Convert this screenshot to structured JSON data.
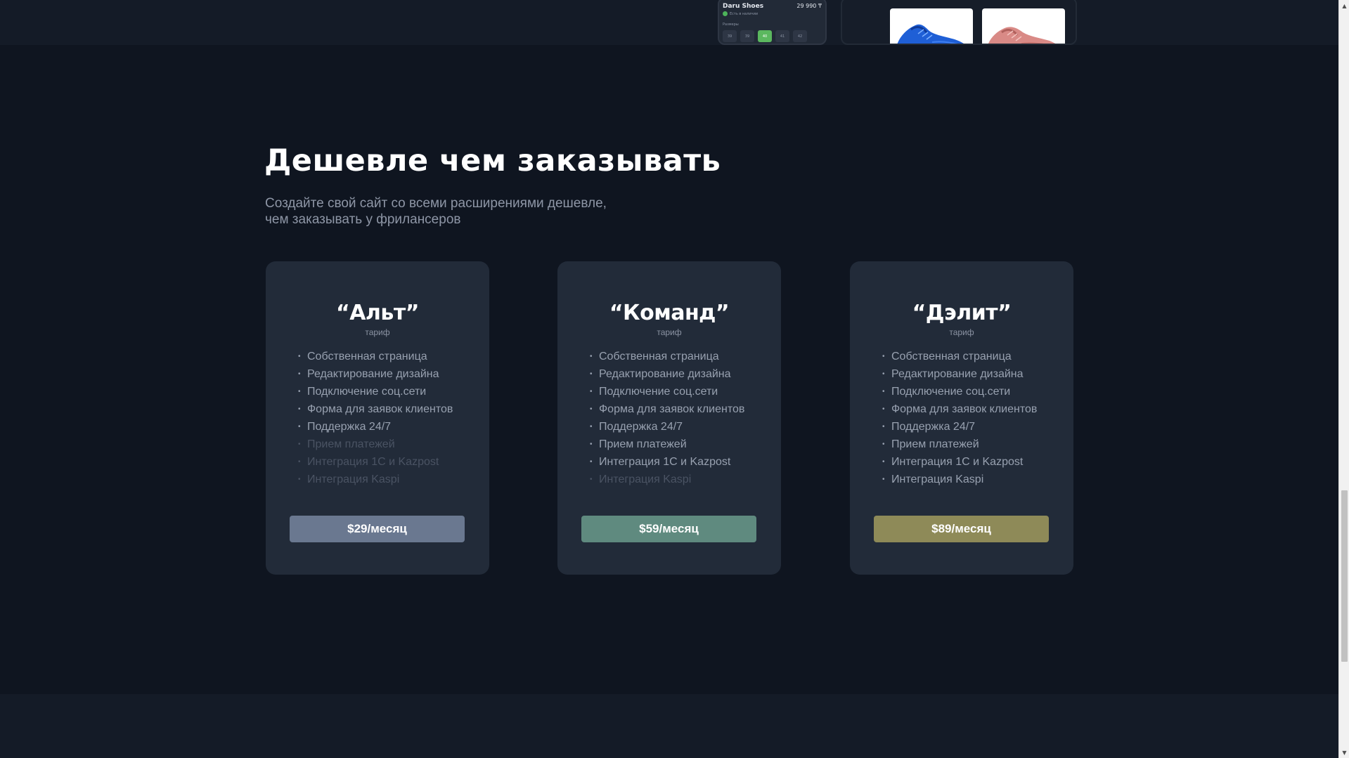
{
  "preview": {
    "brand": "Daru Shoes",
    "price": "29 990 ₸",
    "stock": "Есть в наличии",
    "sizes_label": "Размеры",
    "sizes": [
      "39",
      "39",
      "40",
      "41",
      "42"
    ],
    "active_size_index": 2
  },
  "section": {
    "heading": "Дешевле чем заказывать",
    "subtitle_line1": "Создайте свой сайт со всеми расширениями дешевле,",
    "subtitle_line2": "чем заказывать у фрилансеров"
  },
  "plans": [
    {
      "name": "“Альт”",
      "label": "тариф",
      "price": "$29/месяц",
      "button_color": "#6a7890",
      "features": [
        {
          "text": "Собственная страница",
          "enabled": true
        },
        {
          "text": "Редактирование дизайна",
          "enabled": true
        },
        {
          "text": "Подключение соц.сети",
          "enabled": true
        },
        {
          "text": "Форма для заявок клиентов",
          "enabled": true
        },
        {
          "text": "Поддержка 24/7",
          "enabled": true
        },
        {
          "text": "Прием платежей",
          "enabled": false
        },
        {
          "text": "Интеграция 1С и Kazpost",
          "enabled": false
        },
        {
          "text": "Интеграция Kaspi",
          "enabled": false
        }
      ]
    },
    {
      "name": "“Команд”",
      "label": "тариф",
      "price": "$59/месяц",
      "button_color": "#5f8a7f",
      "features": [
        {
          "text": "Собственная страница",
          "enabled": true
        },
        {
          "text": "Редактирование дизайна",
          "enabled": true
        },
        {
          "text": "Подключение соц.сети",
          "enabled": true
        },
        {
          "text": "Форма для заявок клиентов",
          "enabled": true
        },
        {
          "text": "Поддержка 24/7",
          "enabled": true
        },
        {
          "text": "Прием платежей",
          "enabled": true
        },
        {
          "text": "Интеграция 1С и Kazpost",
          "enabled": true
        },
        {
          "text": "Интеграция Kaspi",
          "enabled": false
        }
      ]
    },
    {
      "name": "“Дэлит”",
      "label": "тариф",
      "price": "$89/месяц",
      "button_color": "#8e8a58",
      "features": [
        {
          "text": "Собственная страница",
          "enabled": true
        },
        {
          "text": "Редактирование дизайна",
          "enabled": true
        },
        {
          "text": "Подключение соц.сети",
          "enabled": true
        },
        {
          "text": "Форма для заявок клиентов",
          "enabled": true
        },
        {
          "text": "Поддержка 24/7",
          "enabled": true
        },
        {
          "text": "Прием платежей",
          "enabled": true
        },
        {
          "text": "Интеграция 1С и Kazpost",
          "enabled": true
        },
        {
          "text": "Интеграция Kaspi",
          "enabled": true
        }
      ]
    }
  ],
  "colors": {
    "background": "#0f1520",
    "card": "#222b39",
    "feature_enabled": "#98a1b0",
    "feature_disabled": "#4a5363"
  }
}
